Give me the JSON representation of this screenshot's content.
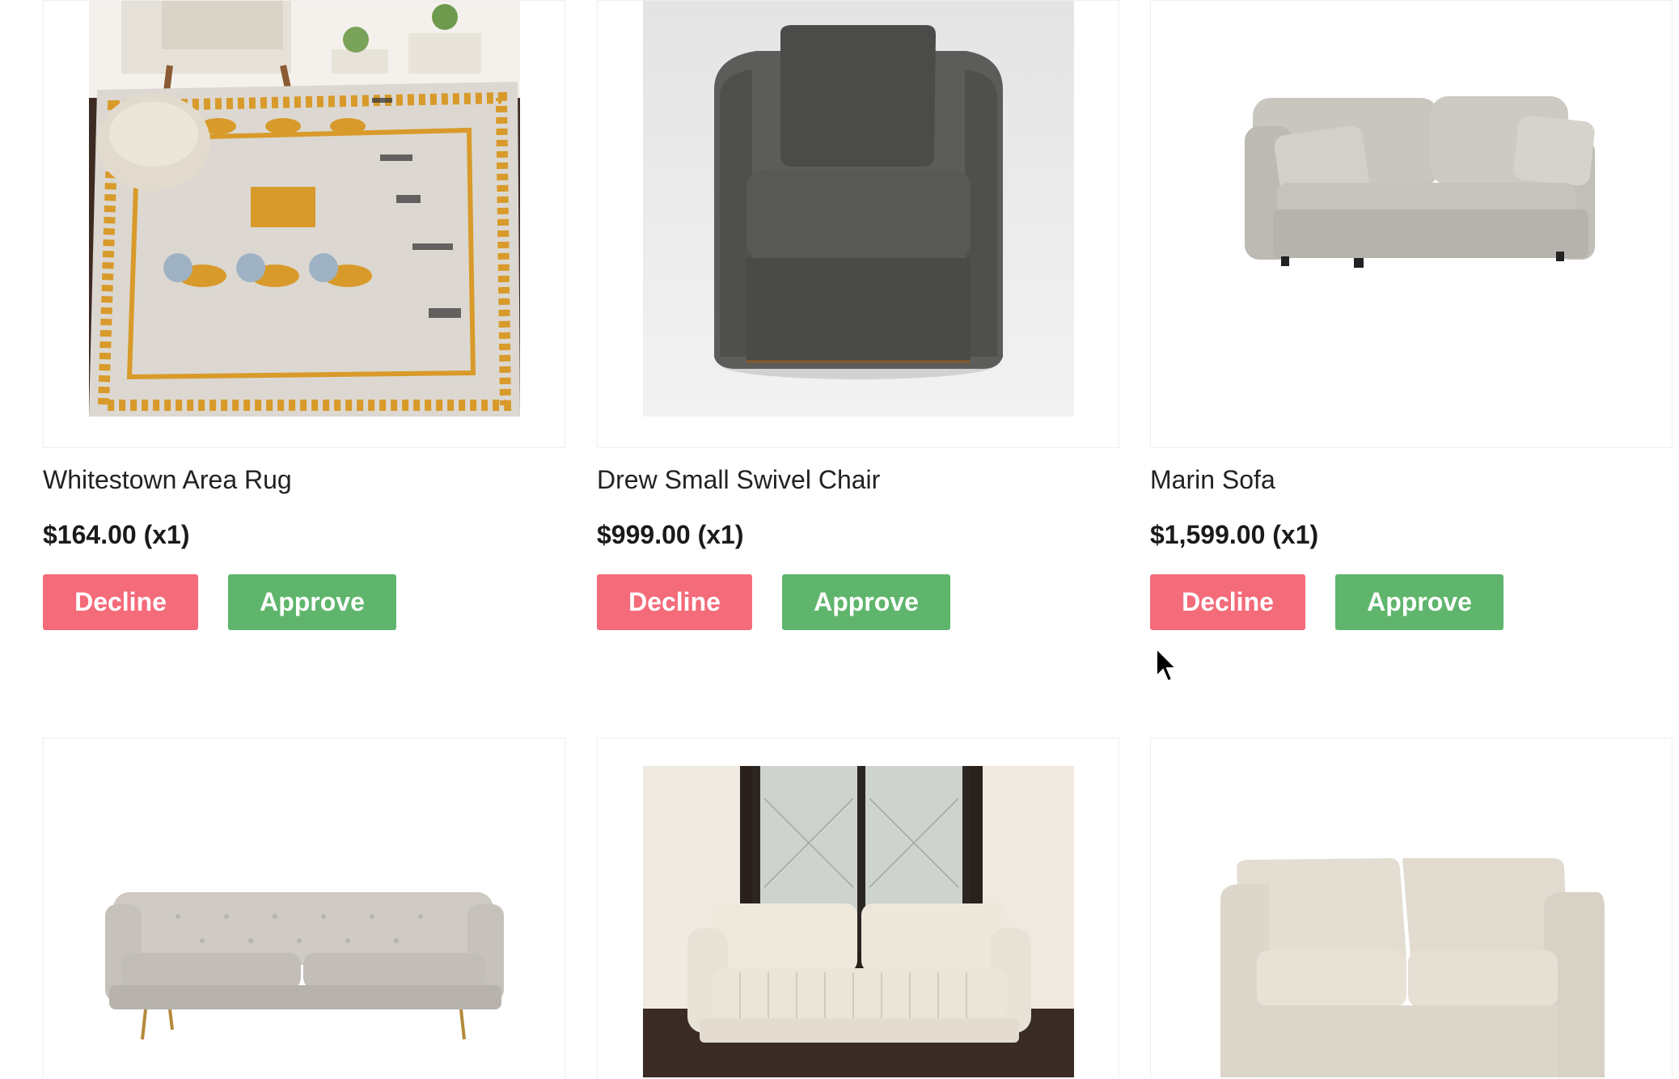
{
  "products": [
    {
      "name": "Whitestown Area Rug",
      "price": "$164.00 (x1)",
      "image_icon": "area-rug-photo"
    },
    {
      "name": "Drew Small Swivel Chair",
      "price": "$999.00 (x1)",
      "image_icon": "swivel-chair-photo"
    },
    {
      "name": "Marin Sofa",
      "price": "$1,599.00 (x1)",
      "image_icon": "sofa-photo"
    },
    {
      "name": "",
      "price": "",
      "image_icon": "tufted-sofa-photo"
    },
    {
      "name": "",
      "price": "",
      "image_icon": "channel-sofa-photo"
    },
    {
      "name": "",
      "price": "",
      "image_icon": "loveseat-photo"
    }
  ],
  "actions": {
    "decline_label": "Decline",
    "approve_label": "Approve"
  },
  "colors": {
    "decline": "#f46b7a",
    "approve": "#5fb56c"
  }
}
